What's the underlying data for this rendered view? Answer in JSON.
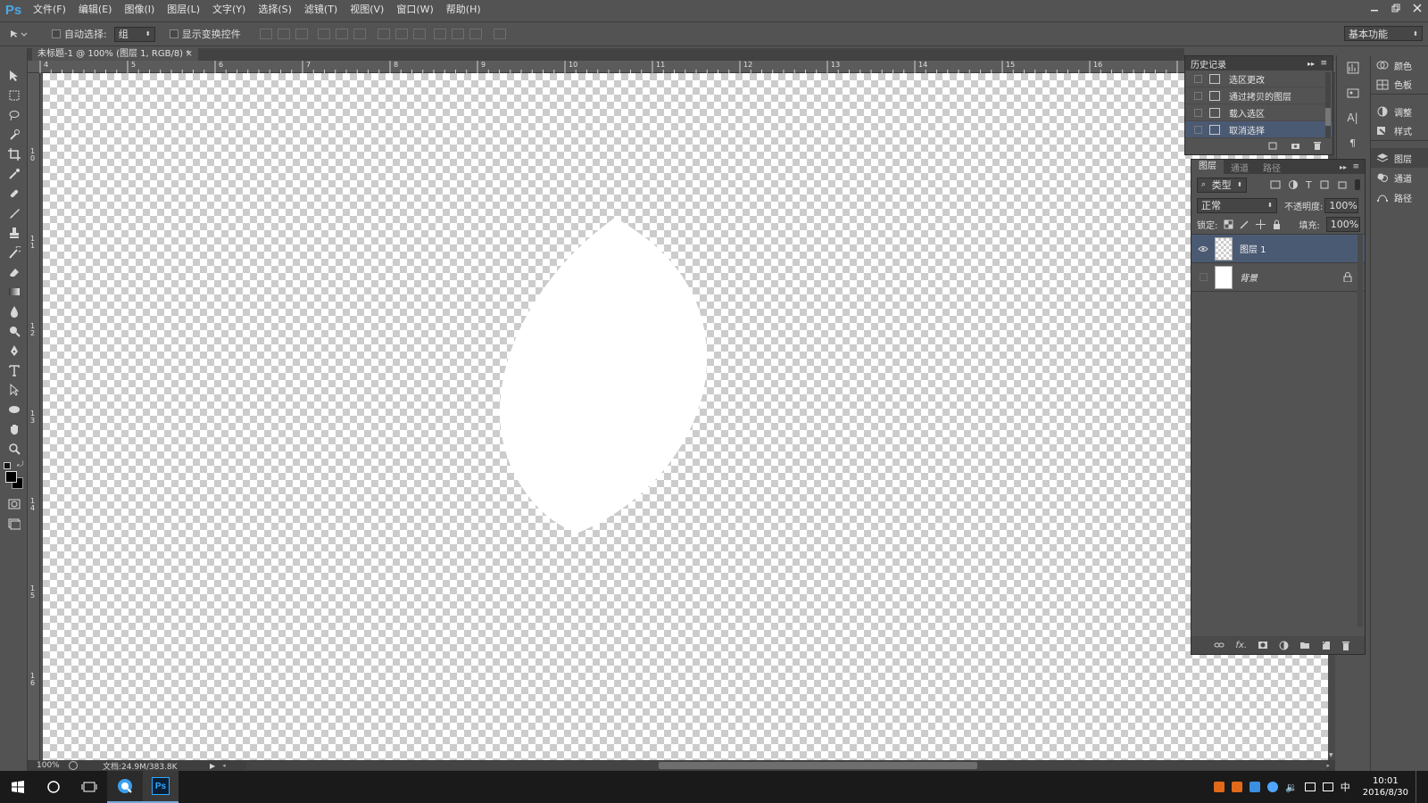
{
  "app": {
    "logo": "Ps"
  },
  "menu": [
    "文件(F)",
    "编辑(E)",
    "图像(I)",
    "图层(L)",
    "文字(Y)",
    "选择(S)",
    "滤镜(T)",
    "视图(V)",
    "窗口(W)",
    "帮助(H)"
  ],
  "options": {
    "auto_select_label": "自动选择:",
    "auto_select_value": "组",
    "show_transform_label": "显示变换控件",
    "workspace": "基本功能"
  },
  "document": {
    "tab_title": "未标题-1 @ 100% (图层 1, RGB/8) *",
    "zoom": "100%",
    "doc_size": "文档:24.9M/383.8K"
  },
  "ruler": {
    "top_ticks": [
      "4",
      "5",
      "6",
      "7",
      "8",
      "9",
      "10",
      "11",
      "12",
      "13",
      "14",
      "15",
      "16"
    ],
    "left_ticks": [
      "1 0",
      "1 1",
      "1 2",
      "1 3",
      "1 4",
      "1 5",
      "1 6"
    ]
  },
  "history": {
    "title": "历史记录",
    "items": [
      "选区更改",
      "通过拷贝的图层",
      "载入选区",
      "取消选择"
    ],
    "selected_index": 3
  },
  "layers": {
    "tabs": [
      "图层",
      "通道",
      "路径"
    ],
    "filter_label": "类型",
    "blend_mode": "正常",
    "opacity_label": "不透明度:",
    "opacity_value": "100%",
    "lock_label": "锁定:",
    "fill_label": "填充:",
    "fill_value": "100%",
    "items": [
      {
        "name": "图层 1",
        "selected": true,
        "visible": true
      },
      {
        "name": "背景",
        "selected": false,
        "visible": false,
        "locked": true
      }
    ]
  },
  "dock": [
    "颜色",
    "色板",
    "调整",
    "样式",
    "图层",
    "通道",
    "路径"
  ],
  "taskbar": {
    "time": "10:01",
    "date": "2016/8/30",
    "ime": "中",
    "apps": [
      "windows-start",
      "cortana-search",
      "task-view",
      "qq-browser",
      "photoshop"
    ]
  },
  "colors": {
    "accent_ps": "#4aa8e8",
    "selected_row": "#4b5a73",
    "taskbar": "#1a1a1a"
  }
}
